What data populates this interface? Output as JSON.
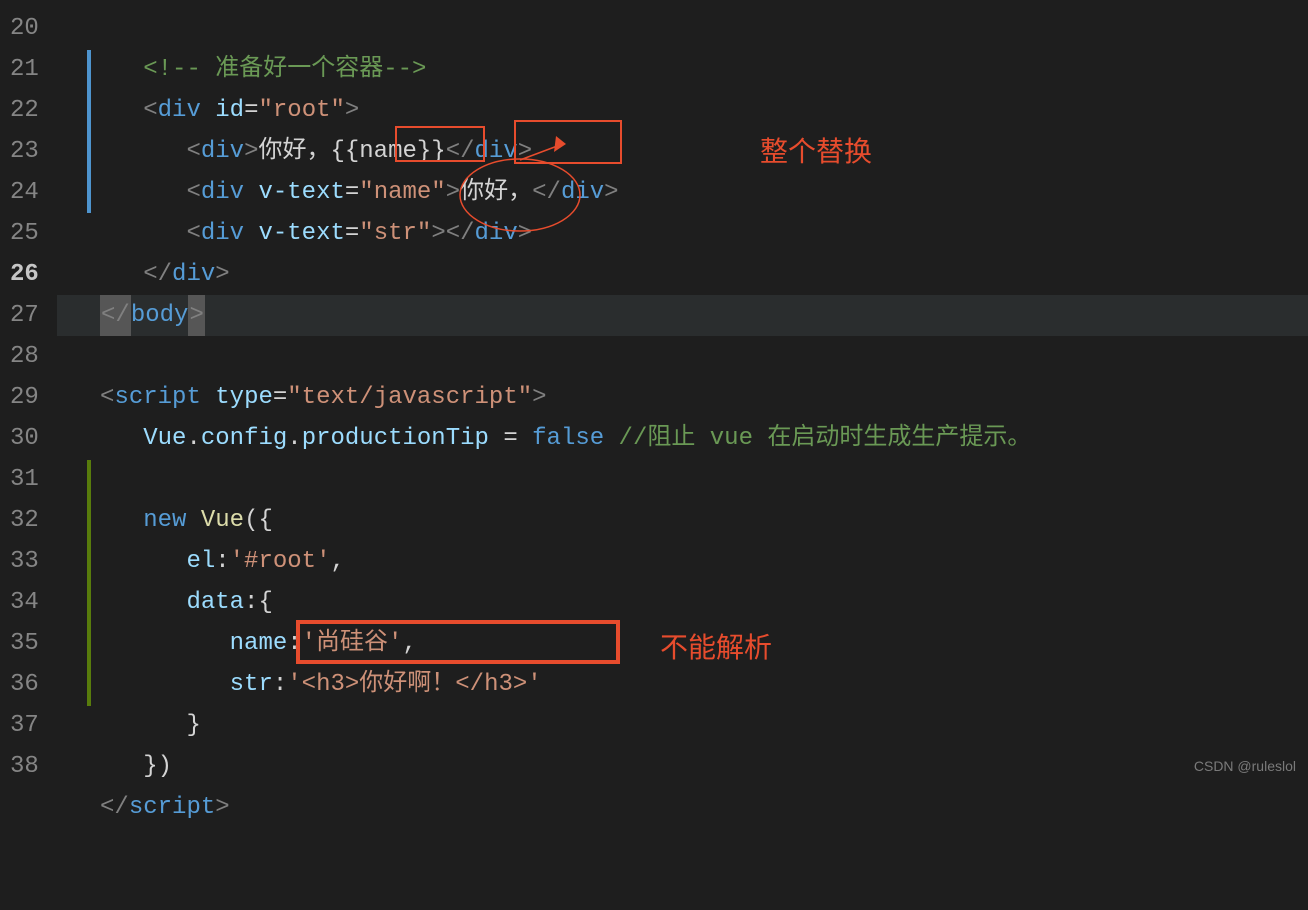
{
  "lines": {
    "start": 20,
    "end": 38,
    "active": 26
  },
  "code": {
    "l20": {
      "comment": "<!-- 准备好一个容器-->"
    },
    "l21": {
      "open": "<",
      "tag": "div",
      "attr": "id",
      "val": "\"root\"",
      "close": ">"
    },
    "l22": {
      "open": "<",
      "tag": "div",
      "close1": ">",
      "text": "你好，{{name}}",
      "endopen": "</",
      "endtag": "div",
      "endclose": ">"
    },
    "l23": {
      "open": "<",
      "tag": "div",
      "attr": "v-text",
      "val": "\"name\"",
      "close1": ">",
      "text": "你好，",
      "endopen": "</",
      "endtag": "div",
      "endclose": ">"
    },
    "l24": {
      "open": "<",
      "tag": "div",
      "attr": "v-text",
      "val": "\"str\"",
      "close1": ">",
      "endopen": "</",
      "endtag": "div",
      "endclose": ">"
    },
    "l25": {
      "endopen": "</",
      "tag": "div",
      "endclose": ">"
    },
    "l26": {
      "endopen": "</",
      "tag": "body",
      "endclose": ">"
    },
    "l28": {
      "open": "<",
      "tag": "script",
      "attr": "type",
      "val": "\"text/javascript\"",
      "close": ">"
    },
    "l29": {
      "obj": "Vue",
      "dot1": ".",
      "p1": "config",
      "dot2": ".",
      "p2": "productionTip",
      "eq": " = ",
      "val": "false",
      "cmt": " //阻止 vue 在启动时生成生产提示。"
    },
    "l31": {
      "kw": "new",
      "cls": "Vue",
      "open": "({"
    },
    "l32": {
      "key": "el",
      "colon": ":",
      "val": "'#root'",
      "comma": ","
    },
    "l33": {
      "key": "data",
      "colon": ":",
      "brace": "{"
    },
    "l34": {
      "key": "name",
      "colon": ":",
      "val": "'尚硅谷'",
      "comma": ","
    },
    "l35": {
      "key": "str",
      "colon": ":",
      "val": "'<h3>你好啊！</h3>'"
    },
    "l36": {
      "brace": "}"
    },
    "l37": {
      "close": "})"
    },
    "l38": {
      "endopen": "</",
      "tag": "script",
      "endclose": ">"
    }
  },
  "annotations": {
    "replace": "整个替换",
    "noparse": "不能解析"
  },
  "watermark": "CSDN @ruleslol"
}
